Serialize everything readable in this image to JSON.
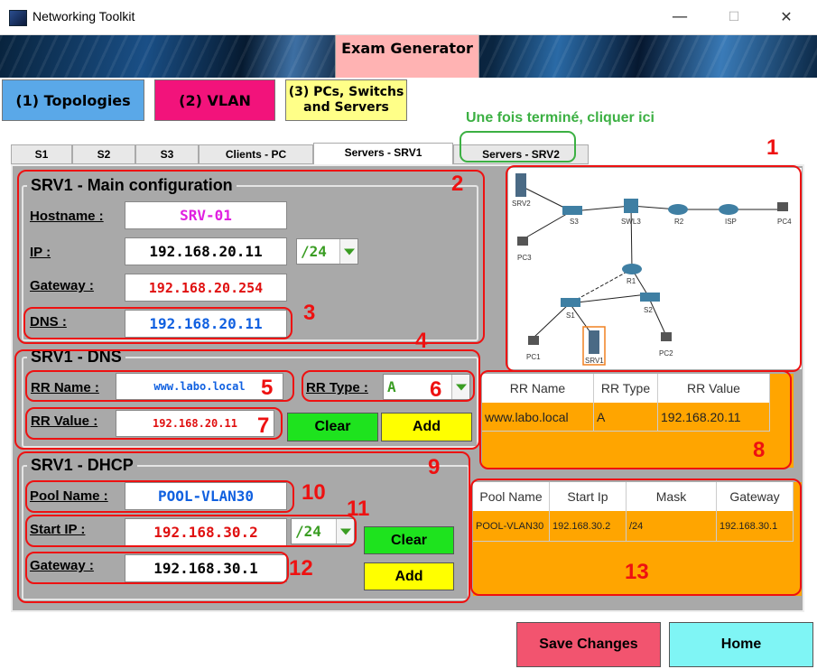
{
  "window": {
    "title": "Networking Toolkit",
    "minimize": "—",
    "maximize": "☐",
    "close": "✕"
  },
  "banner": {
    "exam_generator": "Exam Generator"
  },
  "nav": {
    "topologies": "(1) Topologies",
    "vlan": "(2) VLAN",
    "pcs": "(3) PCs, Switchs and Servers"
  },
  "hint": "Une fois terminé, cliquer ici",
  "tabs": [
    "S1",
    "S2",
    "S3",
    "Clients - PC",
    "Servers - SRV1",
    "Servers - SRV2"
  ],
  "active_tab": "Servers - SRV1",
  "main": {
    "title": "SRV1 - Main configuration",
    "hostname_label": "Hostname :",
    "hostname": "SRV-01",
    "ip_label": "IP :",
    "ip": "192.168.20.11",
    "mask": "/24",
    "gateway_label": "Gateway :",
    "gateway": "192.168.20.254",
    "dns_label": "DNS :",
    "dns": "192.168.20.11"
  },
  "dns": {
    "title": "SRV1 - DNS",
    "rr_name_label": "RR Name :",
    "rr_name": "www.labo.local",
    "rr_type_label": "RR Type :",
    "rr_type": "A",
    "rr_value_label": "RR Value :",
    "rr_value": "192.168.20.11",
    "clear": "Clear",
    "add": "Add",
    "table": {
      "headers": [
        "RR Name",
        "RR Type",
        "RR Value"
      ],
      "rows": [
        [
          "www.labo.local",
          "A",
          "192.168.20.11"
        ]
      ]
    }
  },
  "dhcp": {
    "title": "SRV1 - DHCP",
    "pool_label": "Pool Name :",
    "pool": "POOL-VLAN30",
    "start_label": "Start IP :",
    "start_ip": "192.168.30.2",
    "mask": "/24",
    "gateway_label": "Gateway :",
    "gateway": "192.168.30.1",
    "clear": "Clear",
    "add": "Add",
    "table": {
      "headers": [
        "Pool Name",
        "Start Ip",
        "Mask",
        "Gateway"
      ],
      "rows": [
        [
          "POOL-VLAN30",
          "192.168.30.2",
          "/24",
          "192.168.30.1"
        ]
      ]
    }
  },
  "topology": {
    "devices": [
      "SRV2",
      "S3",
      "SWL3",
      "R2",
      "ISP",
      "PC4",
      "PC3",
      "R1",
      "S1",
      "S2",
      "PC1",
      "SRV1",
      "PC2"
    ]
  },
  "annotations": [
    "1",
    "2",
    "3",
    "4",
    "5",
    "6",
    "7",
    "8",
    "9",
    "10",
    "11",
    "12",
    "13"
  ],
  "footer": {
    "save": "Save Changes",
    "home": "Home"
  },
  "colors": {
    "hostname": "#e020e0",
    "ip": "#000000",
    "gateway": "#e01010",
    "dns": "#1060e0",
    "hint": "#3cb043",
    "table_bg": "#ffa500"
  }
}
